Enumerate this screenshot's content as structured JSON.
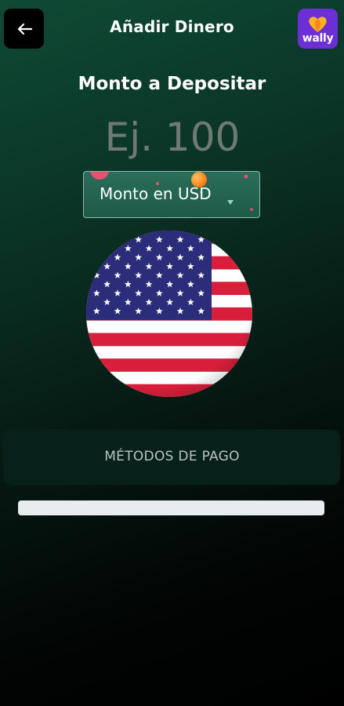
{
  "header": {
    "title": "Añadir Dinero",
    "back_icon": "arrow-left-icon",
    "logo_text": "wally",
    "logo_color": "#6c2fd6"
  },
  "deposit": {
    "label": "Monto a Depositar",
    "placeholder": "Ej. 100",
    "currency_selected": "Monto en USD",
    "flag_icon": "us-flag-icon"
  },
  "payment_methods": {
    "label": "MÉTODOS DE PAGO"
  },
  "colors": {
    "background_top": "#0f4a35",
    "background_bottom": "#000000",
    "currency_button": "#1e5a48",
    "flag_red": "#d91e3c",
    "flag_blue": "#2b2d7a"
  }
}
